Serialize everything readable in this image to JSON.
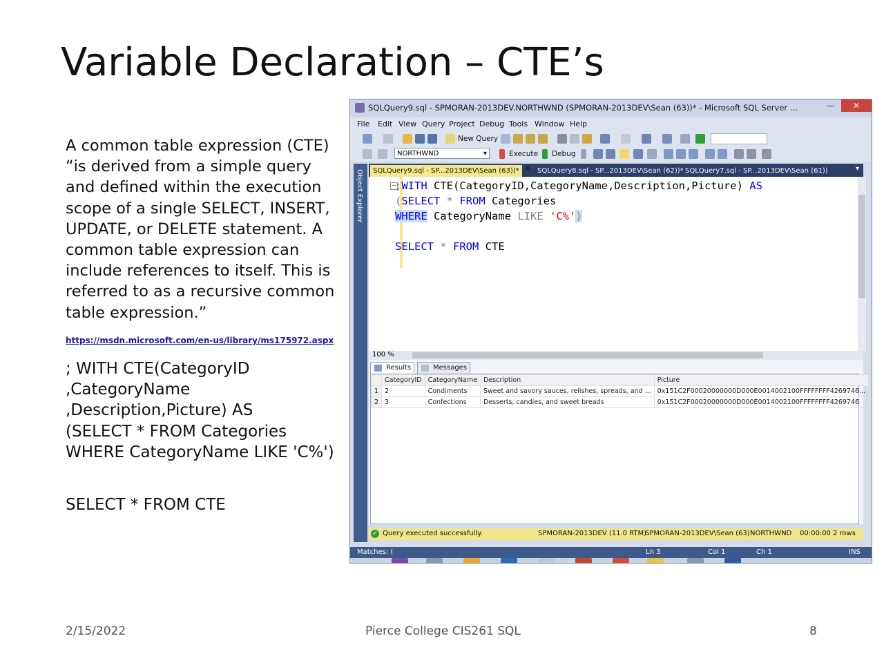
{
  "slide": {
    "title": "Variable Declaration – CTE’s",
    "quote": "A common table expression (CTE) “is derived from a simple query and defined within the execution scope of a single SELECT, INSERT, UPDATE, or DELETE statement. A common table expression can include references to itself. This is referred to as a recursive common table expression.”",
    "link": "https://msdn.microsoft.com/en-us/library/ms175972.aspx",
    "code_lines": [
      "; WITH CTE(CategoryID",
      ",CategoryName",
      ",Description,Picture) AS",
      "(SELECT * FROM Categories",
      "WHERE CategoryName LIKE 'C%')"
    ],
    "select_line": "SELECT * FROM CTE",
    "footer_date": "2/15/2022",
    "footer_center": "Pierce College CIS261 SQL",
    "page_number": "8"
  },
  "ssms": {
    "window_title": "SQLQuery9.sql - SPMORAN-2013DEV.NORTHWND (SPMORAN-2013DEV\\Sean (63))* - Microsoft SQL Server ...",
    "menu": [
      "File",
      "Edit",
      "View",
      "Query",
      "Project",
      "Debug",
      "Tools",
      "Window",
      "Help"
    ],
    "toolbar1": {
      "new_query": "New Query"
    },
    "toolbar2": {
      "database": "NORTHWND",
      "execute": "Execute",
      "debug": "Debug"
    },
    "object_explorer": "Object Explorer",
    "tabs": [
      "SQLQuery9.sql - SP...2013DEV\\Sean (63))*",
      "SQLQuery8.sql - SP...2013DEV\\Sean (62))*",
      "SQLQuery7.sql - SP...2013DEV\\Sean (61))"
    ],
    "editor": {
      "line1": {
        "prefix": ";",
        "kw_with": "WITH",
        "rest": " CTE(CategoryID,CategoryName,Description,Picture) ",
        "kw_as": "AS"
      },
      "line2": {
        "open": "(",
        "kw_select": "SELECT",
        "star": " * ",
        "kw_from": "FROM",
        "table": " Categories"
      },
      "line3": {
        "kw_where": "WHERE",
        "col": " CategoryName ",
        "kw_like": "LIKE",
        "str": " 'C%'",
        "close": ")"
      },
      "line5": {
        "kw_select": "SELECT",
        "star": " * ",
        "kw_from": "FROM",
        "table": " CTE"
      }
    },
    "zoom": "100 %",
    "results_tabs": {
      "results": "Results",
      "messages": "Messages"
    },
    "grid": {
      "columns": [
        "CategoryID",
        "CategoryName",
        "Description",
        "Picture"
      ],
      "rows": [
        {
          "n": "1",
          "CategoryID": "2",
          "CategoryName": "Condiments",
          "Description": "Sweet and savory sauces, relishes, spreads, and ...",
          "Picture": "0x151C2F00020000000D000E0014002100FFFFFFFF4269746..."
        },
        {
          "n": "2",
          "CategoryID": "3",
          "CategoryName": "Confections",
          "Description": "Desserts, candies, and sweet breads",
          "Picture": "0x151C2F00020000000D000E0014002100FFFFFFFF4269746"
        }
      ]
    },
    "status": {
      "message": "Query executed successfully.",
      "server": "SPMORAN-2013DEV (11.0 RTM)",
      "user": "SPMORAN-2013DEV\\Sean (63)",
      "db": "NORTHWND",
      "time": "00:00:00",
      "rows": "2 rows"
    },
    "outer_status": {
      "matches": "Matches: (",
      "ln": "Ln 3",
      "col": "Col 1",
      "ch": "Ch 1",
      "ins": "INS"
    }
  }
}
